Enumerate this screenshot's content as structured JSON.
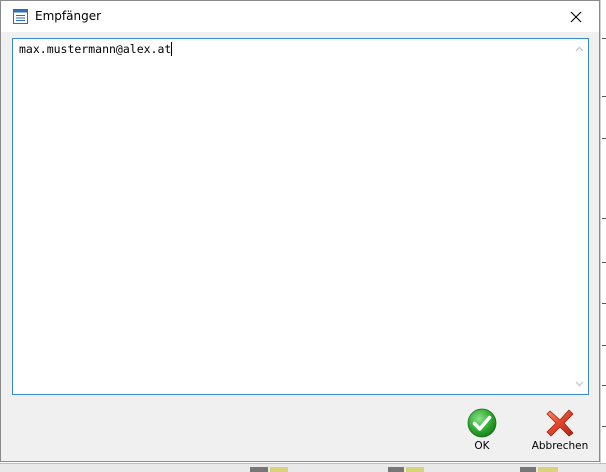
{
  "window": {
    "title": "Empfänger",
    "icon": "list-document-icon",
    "close_icon": "close-icon"
  },
  "recipients_text": {
    "value": "max.mustermann@alex.at"
  },
  "buttons": {
    "ok_label": "OK",
    "ok_icon": "green-check-icon",
    "cancel_label": "Abbrechen",
    "cancel_icon": "red-x-icon"
  },
  "colors": {
    "focus_border": "#3a8bd0",
    "ok_green": "#2eaa2e",
    "cancel_red": "#e0452b"
  }
}
